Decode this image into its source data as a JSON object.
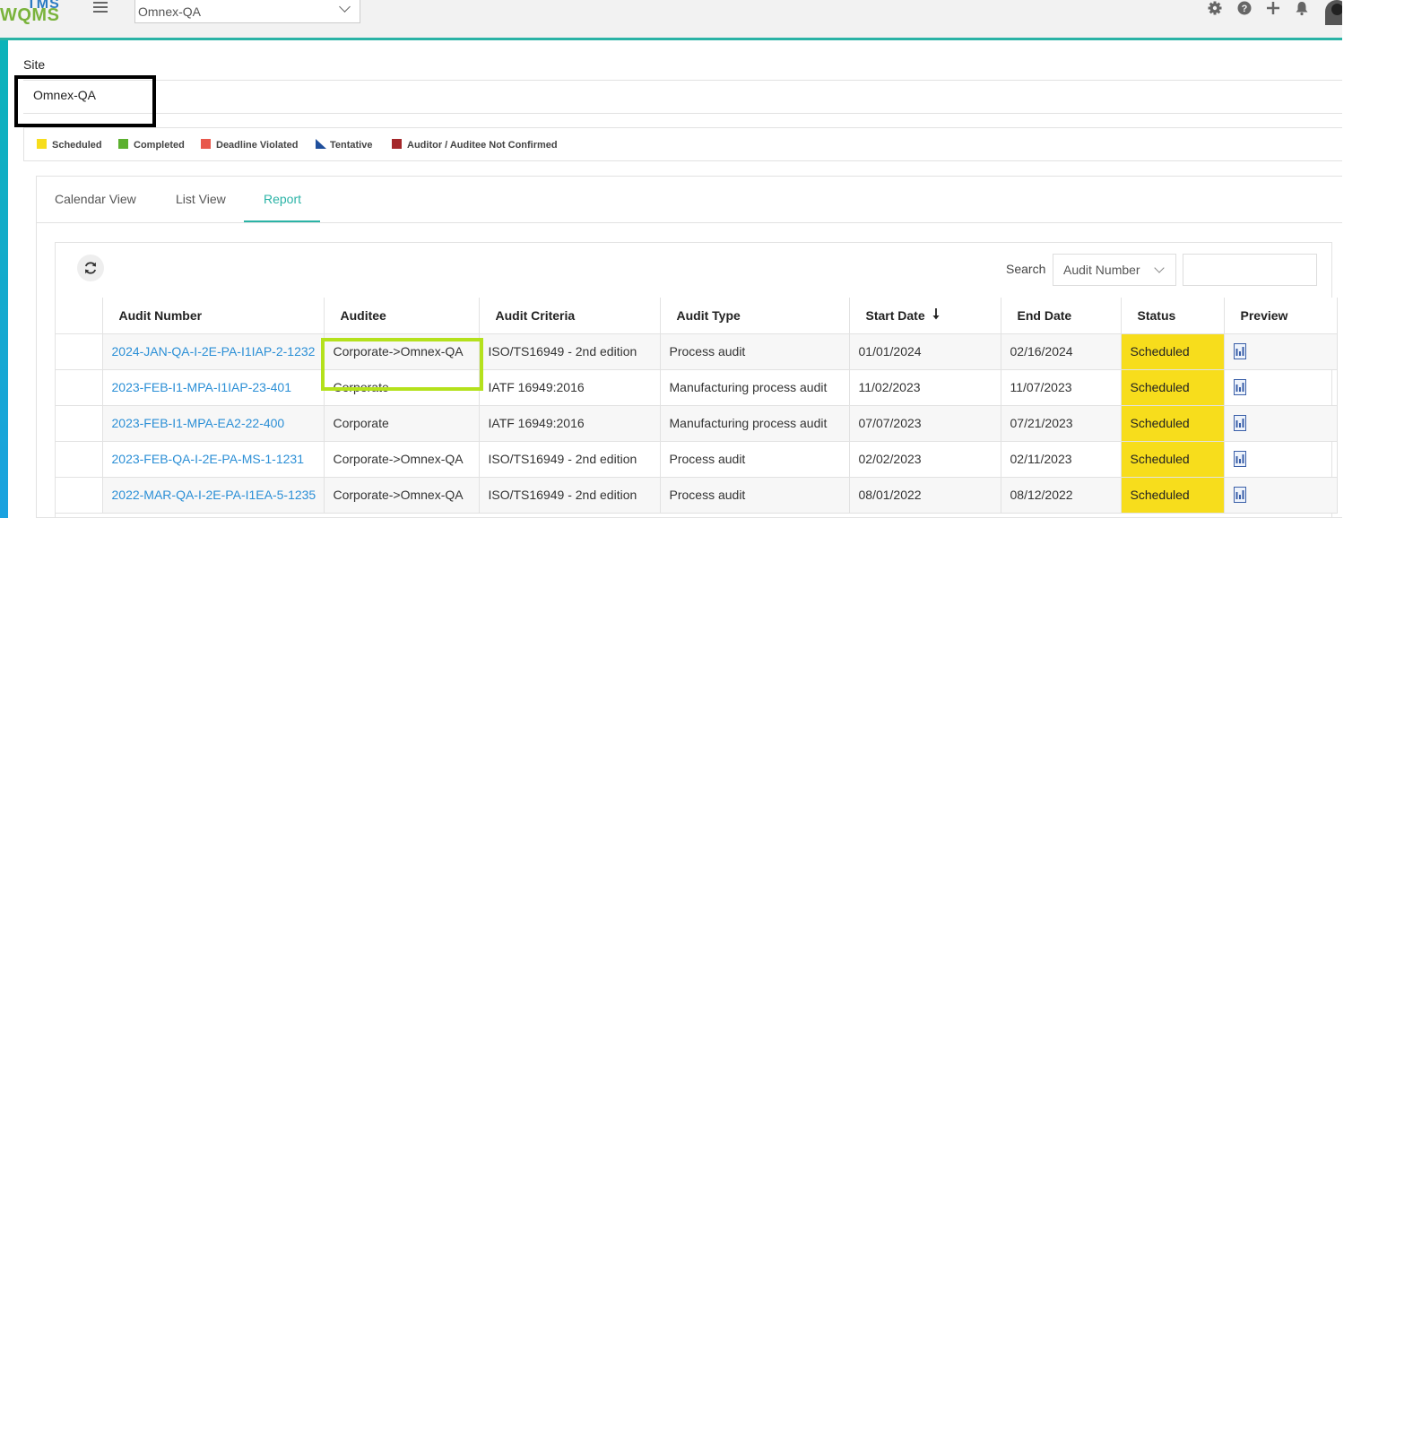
{
  "header": {
    "logo_top": "TMS",
    "logo_main": "WQMS",
    "site_dropdown": "Omnex-QA",
    "icons": [
      "gear-icon",
      "help-icon",
      "plus-icon",
      "bell-icon",
      "user-avatar-icon"
    ]
  },
  "site": {
    "label": "Site",
    "value": "Omnex-QA"
  },
  "legend": [
    {
      "label": "Scheduled",
      "color": "#f7dd1c",
      "shape": "square"
    },
    {
      "label": "Completed",
      "color": "#5cb02f",
      "shape": "square"
    },
    {
      "label": "Deadline Violated",
      "color": "#e8584c",
      "shape": "square"
    },
    {
      "label": "Tentative",
      "color": "#1f4f9c",
      "shape": "triangle"
    },
    {
      "label": "Auditor / Auditee Not Confirmed",
      "color": "#a4272a",
      "shape": "square"
    }
  ],
  "tabs": [
    {
      "label": "Calendar View",
      "active": false
    },
    {
      "label": "List View",
      "active": false
    },
    {
      "label": "Report",
      "active": true
    }
  ],
  "toolbar": {
    "search_label": "Search",
    "search_field_selected": "Audit Number",
    "search_value": ""
  },
  "table": {
    "columns": [
      "Audit Number",
      "Auditee",
      "Audit Criteria",
      "Audit Type",
      "Start Date",
      "End Date",
      "Status",
      "Preview"
    ],
    "sort_column": "Start Date",
    "rows": [
      {
        "audit_number": "2024-JAN-QA-I-2E-PA-I1IAP-2-1232",
        "auditee": "Corporate->Omnex-QA",
        "criteria": "ISO/TS16949 - 2nd edition",
        "type": "Process audit",
        "start": "01/01/2024",
        "end": "02/16/2024",
        "status": "Scheduled"
      },
      {
        "audit_number": "2023-FEB-I1-MPA-I1IAP-23-401",
        "auditee": "Corporate",
        "criteria": "IATF 16949:2016",
        "type": "Manufacturing process audit",
        "start": "11/02/2023",
        "end": "11/07/2023",
        "status": "Scheduled"
      },
      {
        "audit_number": "2023-FEB-I1-MPA-EA2-22-400",
        "auditee": "Corporate",
        "criteria": "IATF 16949:2016",
        "type": "Manufacturing process audit",
        "start": "07/07/2023",
        "end": "07/21/2023",
        "status": "Scheduled"
      },
      {
        "audit_number": "2023-FEB-QA-I-2E-PA-MS-1-1231",
        "auditee": "Corporate->Omnex-QA",
        "criteria": "ISO/TS16949 - 2nd edition",
        "type": "Process audit",
        "start": "02/02/2023",
        "end": "02/11/2023",
        "status": "Scheduled"
      },
      {
        "audit_number": "2022-MAR-QA-I-2E-PA-I1EA-5-1235",
        "auditee": "Corporate->Omnex-QA",
        "criteria": "ISO/TS16949 - 2nd edition",
        "type": "Process audit",
        "start": "08/01/2022",
        "end": "08/12/2022",
        "status": "Scheduled"
      }
    ]
  },
  "colors": {
    "accent": "#2ab3a6",
    "link": "#2b8fd6",
    "scheduled": "#f7dd1c",
    "highlight_box": "#b4e11c"
  }
}
